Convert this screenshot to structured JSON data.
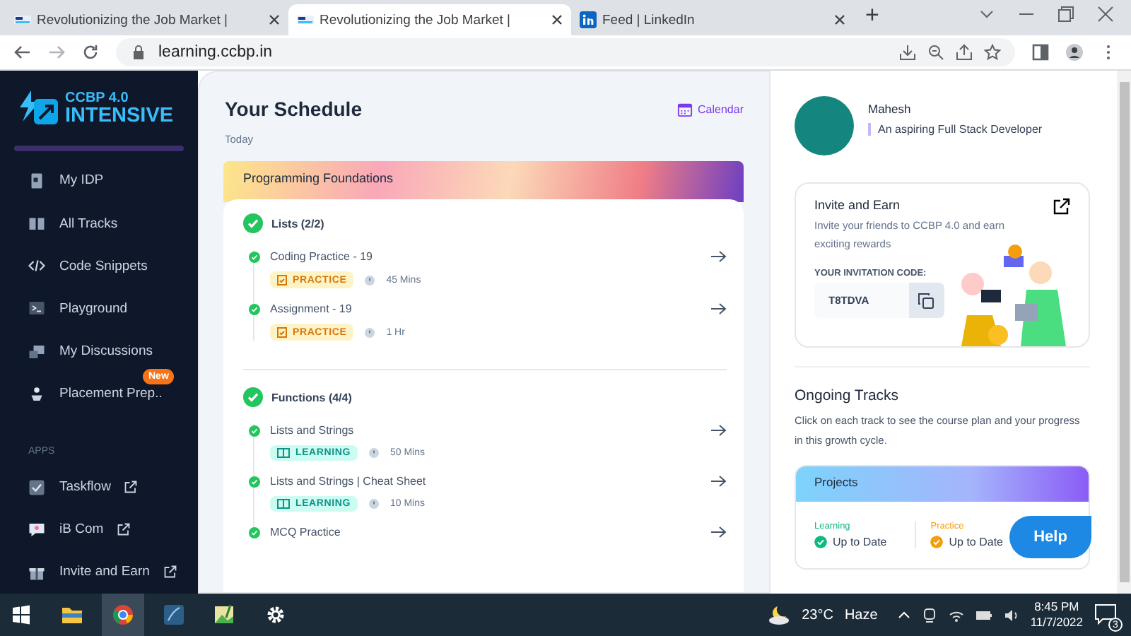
{
  "browser": {
    "tabs": [
      {
        "title": "Revolutionizing the Job Market |",
        "kind": "ccbp",
        "selected": false
      },
      {
        "title": "Revolutionizing the Job Market |",
        "kind": "ccbp",
        "selected": true
      },
      {
        "title": "Feed | LinkedIn",
        "kind": "linkedin",
        "selected": false
      }
    ],
    "new_tab": "+",
    "address": "learning.ccbp.in"
  },
  "sidebar": {
    "logo_top": "CCBP 4.0",
    "logo_bottom": "INTENSIVE",
    "items": [
      {
        "label": "My IDP",
        "kind": "document"
      },
      {
        "label": "All Tracks",
        "kind": "book"
      },
      {
        "label": "Code Snippets",
        "kind": "code"
      },
      {
        "label": "Playground",
        "kind": "terminal"
      },
      {
        "label": "My Discussions",
        "kind": "discussion"
      },
      {
        "label": "Placement Prep..",
        "kind": "person",
        "badge": "New"
      }
    ],
    "apps_heading": "APPS",
    "apps": [
      {
        "label": "Taskflow",
        "kind": "checkbox"
      },
      {
        "label": "iB Com",
        "kind": "chat"
      },
      {
        "label": "Invite and Earn",
        "kind": "gift"
      }
    ]
  },
  "schedule": {
    "title": "Your Schedule",
    "calendar_link": "Calendar",
    "subtitle": "Today",
    "course": "Programming Foundations",
    "sections": [
      {
        "title": "Lists (2/2)",
        "completed": true,
        "items": [
          {
            "title": "Coding Practice - 19",
            "completed": true,
            "tag": {
              "kind": "practice",
              "label": "PRACTICE"
            },
            "duration": "45 Mins"
          },
          {
            "title": "Assignment - 19",
            "completed": true,
            "tag": {
              "kind": "practice",
              "label": "PRACTICE"
            },
            "duration": "1 Hr"
          }
        ]
      },
      {
        "title": "Functions (4/4)",
        "completed": true,
        "items": [
          {
            "title": "Lists and Strings",
            "completed": true,
            "tag": {
              "kind": "learning",
              "label": "LEARNING"
            },
            "duration": "50 Mins"
          },
          {
            "title": "Lists and Strings | Cheat Sheet",
            "completed": true,
            "tag": {
              "kind": "learning",
              "label": "LEARNING"
            },
            "duration": "10 Mins"
          },
          {
            "title": "MCQ Practice",
            "completed": true
          }
        ]
      }
    ]
  },
  "profile": {
    "name": "Mahesh",
    "bio": "An aspiring Full Stack Developer"
  },
  "invite": {
    "title": "Invite and Earn",
    "text": "Invite your friends to CCBP 4.0 and earn exciting rewards",
    "code_label": "YOUR INVITATION CODE:",
    "code": "T8TDVA"
  },
  "ongoing": {
    "title": "Ongoing Tracks",
    "description": "Click on each track to see the course plan and your progress in this growth cycle.",
    "track": {
      "title": "Projects",
      "statuses": [
        {
          "label": "Learning",
          "value": "Up to Date",
          "color": "#10b981"
        },
        {
          "label": "Practice",
          "value": "Up to Date",
          "color": "#f59e0b"
        }
      ]
    }
  },
  "help": "Help",
  "taskbar": {
    "apps": [
      {
        "kind": "folder",
        "selected": false
      },
      {
        "kind": "chrome",
        "selected": true
      },
      {
        "kind": "editor",
        "selected": false
      },
      {
        "kind": "image",
        "selected": false
      },
      {
        "kind": "settings",
        "selected": false
      }
    ],
    "temperature": "23°C",
    "weather": "Haze",
    "time": "8:45 PM",
    "date": "11/7/2022",
    "notifications": "3"
  }
}
